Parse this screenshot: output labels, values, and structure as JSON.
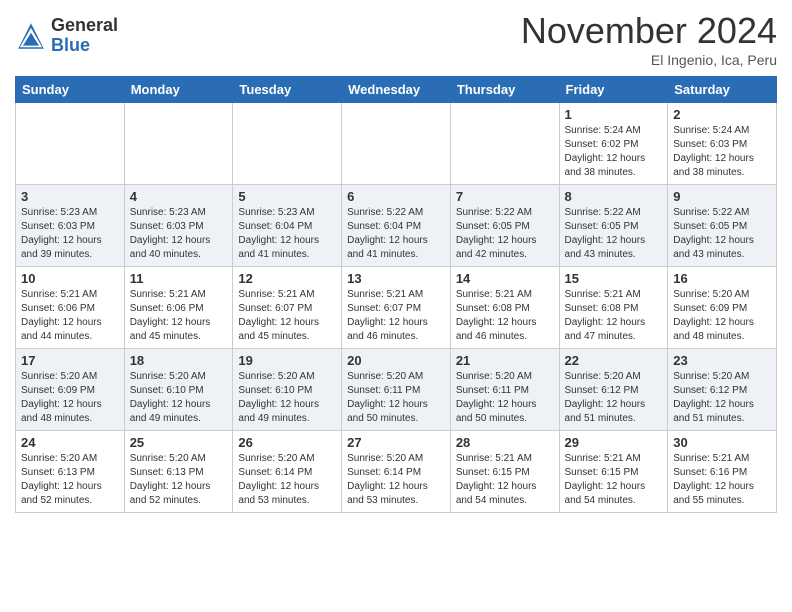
{
  "header": {
    "logo_general": "General",
    "logo_blue": "Blue",
    "month_title": "November 2024",
    "location": "El Ingenio, Ica, Peru"
  },
  "days_of_week": [
    "Sunday",
    "Monday",
    "Tuesday",
    "Wednesday",
    "Thursday",
    "Friday",
    "Saturday"
  ],
  "weeks": [
    [
      {
        "day": "",
        "info": ""
      },
      {
        "day": "",
        "info": ""
      },
      {
        "day": "",
        "info": ""
      },
      {
        "day": "",
        "info": ""
      },
      {
        "day": "",
        "info": ""
      },
      {
        "day": "1",
        "info": "Sunrise: 5:24 AM\nSunset: 6:02 PM\nDaylight: 12 hours\nand 38 minutes."
      },
      {
        "day": "2",
        "info": "Sunrise: 5:24 AM\nSunset: 6:03 PM\nDaylight: 12 hours\nand 38 minutes."
      }
    ],
    [
      {
        "day": "3",
        "info": "Sunrise: 5:23 AM\nSunset: 6:03 PM\nDaylight: 12 hours\nand 39 minutes."
      },
      {
        "day": "4",
        "info": "Sunrise: 5:23 AM\nSunset: 6:03 PM\nDaylight: 12 hours\nand 40 minutes."
      },
      {
        "day": "5",
        "info": "Sunrise: 5:23 AM\nSunset: 6:04 PM\nDaylight: 12 hours\nand 41 minutes."
      },
      {
        "day": "6",
        "info": "Sunrise: 5:22 AM\nSunset: 6:04 PM\nDaylight: 12 hours\nand 41 minutes."
      },
      {
        "day": "7",
        "info": "Sunrise: 5:22 AM\nSunset: 6:05 PM\nDaylight: 12 hours\nand 42 minutes."
      },
      {
        "day": "8",
        "info": "Sunrise: 5:22 AM\nSunset: 6:05 PM\nDaylight: 12 hours\nand 43 minutes."
      },
      {
        "day": "9",
        "info": "Sunrise: 5:22 AM\nSunset: 6:05 PM\nDaylight: 12 hours\nand 43 minutes."
      }
    ],
    [
      {
        "day": "10",
        "info": "Sunrise: 5:21 AM\nSunset: 6:06 PM\nDaylight: 12 hours\nand 44 minutes."
      },
      {
        "day": "11",
        "info": "Sunrise: 5:21 AM\nSunset: 6:06 PM\nDaylight: 12 hours\nand 45 minutes."
      },
      {
        "day": "12",
        "info": "Sunrise: 5:21 AM\nSunset: 6:07 PM\nDaylight: 12 hours\nand 45 minutes."
      },
      {
        "day": "13",
        "info": "Sunrise: 5:21 AM\nSunset: 6:07 PM\nDaylight: 12 hours\nand 46 minutes."
      },
      {
        "day": "14",
        "info": "Sunrise: 5:21 AM\nSunset: 6:08 PM\nDaylight: 12 hours\nand 46 minutes."
      },
      {
        "day": "15",
        "info": "Sunrise: 5:21 AM\nSunset: 6:08 PM\nDaylight: 12 hours\nand 47 minutes."
      },
      {
        "day": "16",
        "info": "Sunrise: 5:20 AM\nSunset: 6:09 PM\nDaylight: 12 hours\nand 48 minutes."
      }
    ],
    [
      {
        "day": "17",
        "info": "Sunrise: 5:20 AM\nSunset: 6:09 PM\nDaylight: 12 hours\nand 48 minutes."
      },
      {
        "day": "18",
        "info": "Sunrise: 5:20 AM\nSunset: 6:10 PM\nDaylight: 12 hours\nand 49 minutes."
      },
      {
        "day": "19",
        "info": "Sunrise: 5:20 AM\nSunset: 6:10 PM\nDaylight: 12 hours\nand 49 minutes."
      },
      {
        "day": "20",
        "info": "Sunrise: 5:20 AM\nSunset: 6:11 PM\nDaylight: 12 hours\nand 50 minutes."
      },
      {
        "day": "21",
        "info": "Sunrise: 5:20 AM\nSunset: 6:11 PM\nDaylight: 12 hours\nand 50 minutes."
      },
      {
        "day": "22",
        "info": "Sunrise: 5:20 AM\nSunset: 6:12 PM\nDaylight: 12 hours\nand 51 minutes."
      },
      {
        "day": "23",
        "info": "Sunrise: 5:20 AM\nSunset: 6:12 PM\nDaylight: 12 hours\nand 51 minutes."
      }
    ],
    [
      {
        "day": "24",
        "info": "Sunrise: 5:20 AM\nSunset: 6:13 PM\nDaylight: 12 hours\nand 52 minutes."
      },
      {
        "day": "25",
        "info": "Sunrise: 5:20 AM\nSunset: 6:13 PM\nDaylight: 12 hours\nand 52 minutes."
      },
      {
        "day": "26",
        "info": "Sunrise: 5:20 AM\nSunset: 6:14 PM\nDaylight: 12 hours\nand 53 minutes."
      },
      {
        "day": "27",
        "info": "Sunrise: 5:20 AM\nSunset: 6:14 PM\nDaylight: 12 hours\nand 53 minutes."
      },
      {
        "day": "28",
        "info": "Sunrise: 5:21 AM\nSunset: 6:15 PM\nDaylight: 12 hours\nand 54 minutes."
      },
      {
        "day": "29",
        "info": "Sunrise: 5:21 AM\nSunset: 6:15 PM\nDaylight: 12 hours\nand 54 minutes."
      },
      {
        "day": "30",
        "info": "Sunrise: 5:21 AM\nSunset: 6:16 PM\nDaylight: 12 hours\nand 55 minutes."
      }
    ]
  ]
}
